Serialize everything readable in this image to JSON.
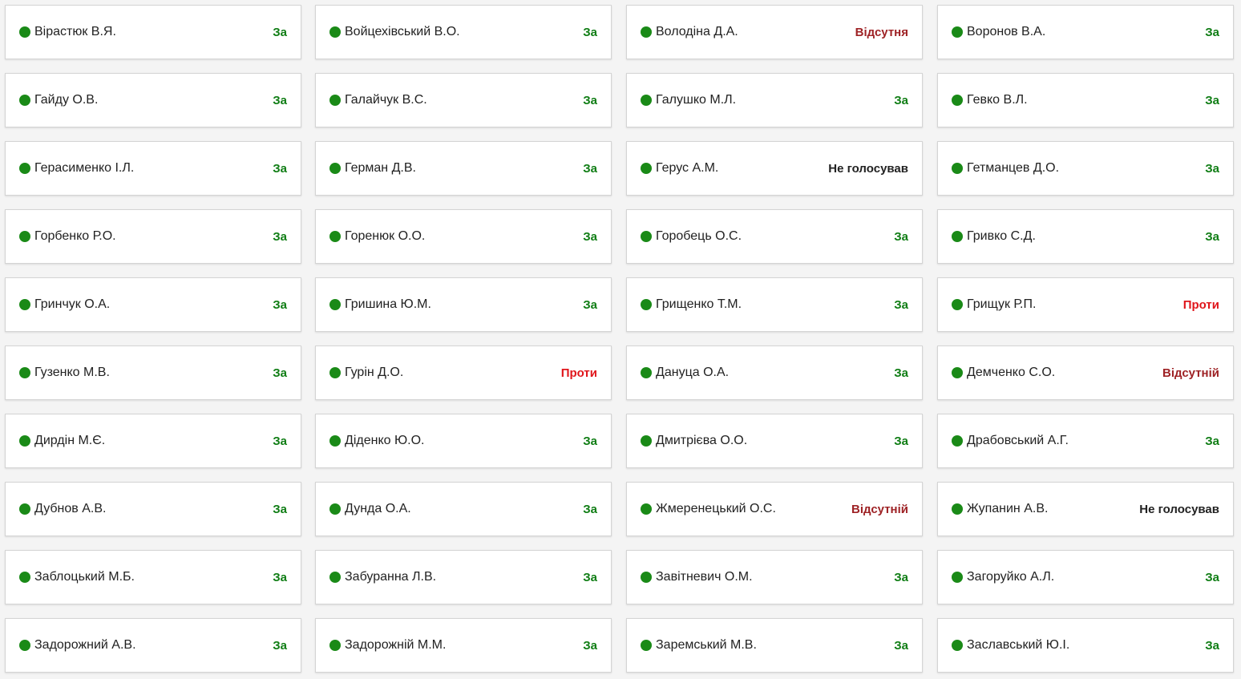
{
  "colors": {
    "dot": "#1a8a17",
    "for": "#0f7d14",
    "against": "#e0161b",
    "absent": "#9e2225",
    "novote": "#222222"
  },
  "deputies": [
    {
      "name": "Вірастюк В.Я.",
      "vote": "За",
      "status": "for"
    },
    {
      "name": "Войцехівський В.О.",
      "vote": "За",
      "status": "for"
    },
    {
      "name": "Володіна Д.А.",
      "vote": "Відсутня",
      "status": "absent"
    },
    {
      "name": "Воронов В.А.",
      "vote": "За",
      "status": "for"
    },
    {
      "name": "Гайду О.В.",
      "vote": "За",
      "status": "for"
    },
    {
      "name": "Галайчук В.С.",
      "vote": "За",
      "status": "for"
    },
    {
      "name": "Галушко М.Л.",
      "vote": "За",
      "status": "for"
    },
    {
      "name": "Гевко В.Л.",
      "vote": "За",
      "status": "for"
    },
    {
      "name": "Герасименко І.Л.",
      "vote": "За",
      "status": "for"
    },
    {
      "name": "Герман Д.В.",
      "vote": "За",
      "status": "for"
    },
    {
      "name": "Герус А.М.",
      "vote": "Не голосував",
      "status": "novote"
    },
    {
      "name": "Гетманцев Д.О.",
      "vote": "За",
      "status": "for"
    },
    {
      "name": "Горбенко Р.О.",
      "vote": "За",
      "status": "for"
    },
    {
      "name": "Горенюк О.О.",
      "vote": "За",
      "status": "for"
    },
    {
      "name": "Горобець О.С.",
      "vote": "За",
      "status": "for"
    },
    {
      "name": "Гривко С.Д.",
      "vote": "За",
      "status": "for"
    },
    {
      "name": "Гринчук О.А.",
      "vote": "За",
      "status": "for"
    },
    {
      "name": "Гришина Ю.М.",
      "vote": "За",
      "status": "for"
    },
    {
      "name": "Грищенко Т.М.",
      "vote": "За",
      "status": "for"
    },
    {
      "name": "Грищук Р.П.",
      "vote": "Проти",
      "status": "against"
    },
    {
      "name": "Гузенко М.В.",
      "vote": "За",
      "status": "for"
    },
    {
      "name": "Гурін Д.О.",
      "vote": "Проти",
      "status": "against"
    },
    {
      "name": "Дануца О.А.",
      "vote": "За",
      "status": "for"
    },
    {
      "name": "Демченко С.О.",
      "vote": "Відсутній",
      "status": "absent"
    },
    {
      "name": "Дирдін М.Є.",
      "vote": "За",
      "status": "for"
    },
    {
      "name": "Діденко Ю.О.",
      "vote": "За",
      "status": "for"
    },
    {
      "name": "Дмитрієва О.О.",
      "vote": "За",
      "status": "for"
    },
    {
      "name": "Драбовський А.Г.",
      "vote": "За",
      "status": "for"
    },
    {
      "name": "Дубнов А.В.",
      "vote": "За",
      "status": "for"
    },
    {
      "name": "Дунда О.А.",
      "vote": "За",
      "status": "for"
    },
    {
      "name": "Жмеренецький О.С.",
      "vote": "Відсутній",
      "status": "absent"
    },
    {
      "name": "Жупанин А.В.",
      "vote": "Не голосував",
      "status": "novote"
    },
    {
      "name": "Заблоцький М.Б.",
      "vote": "За",
      "status": "for"
    },
    {
      "name": "Забуранна Л.В.",
      "vote": "За",
      "status": "for"
    },
    {
      "name": "Завітневич О.М.",
      "vote": "За",
      "status": "for"
    },
    {
      "name": "Загоруйко А.Л.",
      "vote": "За",
      "status": "for"
    },
    {
      "name": "Задорожний А.В.",
      "vote": "За",
      "status": "for"
    },
    {
      "name": "Задорожній М.М.",
      "vote": "За",
      "status": "for"
    },
    {
      "name": "Заремський М.В.",
      "vote": "За",
      "status": "for"
    },
    {
      "name": "Заславський Ю.І.",
      "vote": "За",
      "status": "for"
    }
  ]
}
